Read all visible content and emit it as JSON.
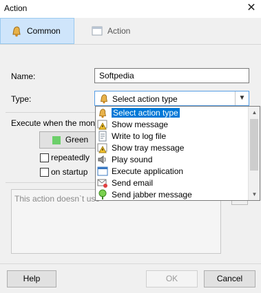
{
  "window": {
    "title": "Action",
    "close_glyph": "✕"
  },
  "tabs": [
    {
      "label": "Common",
      "icon": "bell-icon",
      "active": true
    },
    {
      "label": "Action",
      "icon": "window-icon",
      "active": false
    }
  ],
  "form": {
    "name_label": "Name:",
    "name_value": "Softpedia",
    "type_label": "Type:",
    "type_value": "Select action type",
    "execute_label": "Execute when the monito",
    "green_button": "Green",
    "repeatedly_label": "repeatedly",
    "on_startup_label": "on startup",
    "description_text": "This action doesn`t use"
  },
  "dropdown": {
    "items": [
      {
        "label": "Select action type",
        "icon": "bell-icon",
        "selected": true
      },
      {
        "label": "Show message",
        "icon": "message-warning-icon",
        "selected": false
      },
      {
        "label": "Write to log file",
        "icon": "log-file-icon",
        "selected": false
      },
      {
        "label": "Show tray message",
        "icon": "tray-message-icon",
        "selected": false
      },
      {
        "label": "Play sound",
        "icon": "speaker-icon",
        "selected": false
      },
      {
        "label": "Execute application",
        "icon": "application-icon",
        "selected": false
      },
      {
        "label": "Send email",
        "icon": "email-icon",
        "selected": false
      },
      {
        "label": "Send jabber message",
        "icon": "jabber-icon",
        "selected": false
      }
    ]
  },
  "footer": {
    "help": "Help",
    "ok": "OK",
    "cancel": "Cancel"
  },
  "colors": {
    "accent": "#0078d7",
    "tab_active_bg": "#cfe5fb",
    "green": "#6ccf6a"
  }
}
